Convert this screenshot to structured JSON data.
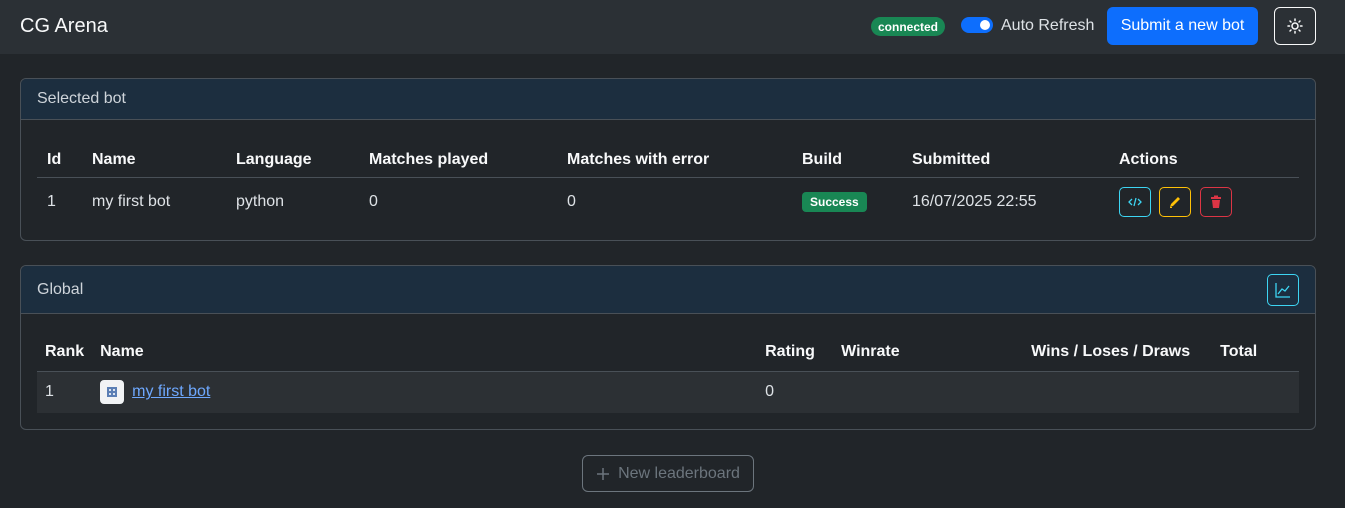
{
  "app": {
    "title": "CG Arena"
  },
  "header": {
    "status": "connected",
    "auto_refresh_label": "Auto Refresh",
    "auto_refresh_on": true,
    "submit_label": "Submit a new bot",
    "theme_icon": "sun-icon"
  },
  "selected_bot": {
    "title": "Selected bot",
    "columns": [
      "Id",
      "Name",
      "Language",
      "Matches played",
      "Matches with error",
      "Build",
      "Submitted",
      "Actions"
    ],
    "row": {
      "id": "1",
      "name": "my first bot",
      "language": "python",
      "matches_played": "0",
      "matches_with_error": "0",
      "build": "Success",
      "submitted": "16/07/2025 22:55"
    },
    "actions": [
      "code-icon",
      "pencil-icon",
      "trash-icon"
    ]
  },
  "global": {
    "title": "Global",
    "chart_icon": "line-chart-icon",
    "columns": [
      "Rank",
      "Name",
      "Rating",
      "Winrate",
      "Wins / Loses / Draws",
      "Total"
    ],
    "rows": [
      {
        "rank": "1",
        "name": "my first bot",
        "rating": "0",
        "winrate": "",
        "wld": "",
        "total": ""
      }
    ]
  },
  "new_leaderboard": {
    "label": "New leaderboard",
    "icon": "plus-icon"
  },
  "colors": {
    "background": "#212529",
    "navbar": "#2b3035",
    "primary": "#0d6efd",
    "success": "#198754",
    "info": "#3dd5f3",
    "warning": "#ffc107",
    "danger": "#dc3545",
    "link": "#6ea8fe"
  }
}
